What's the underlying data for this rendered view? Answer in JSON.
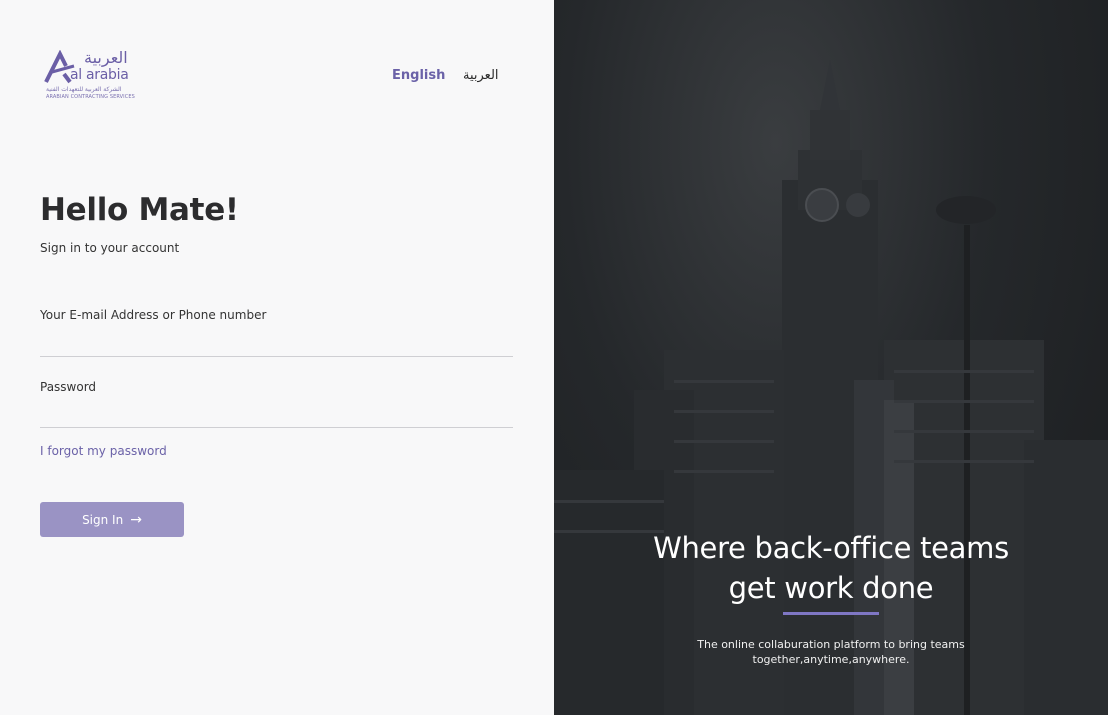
{
  "logo": {
    "arabic_name": "العربية",
    "english_name": "al arabia",
    "arabic_subtitle": "الشركة العربية للتعهدات الفنية",
    "english_subtitle": "ARABIAN CONTRACTING SERVICES"
  },
  "language": {
    "english": "English",
    "arabic": "العربية",
    "selected": "English"
  },
  "login": {
    "title": "Hello Mate!",
    "subtitle": "Sign in to your account",
    "email_label": "Your E-mail Address or Phone number",
    "password_label": "Password",
    "forgot_password": "I forgot my password",
    "sign_in_button": "Sign In",
    "sign_in_icon": "arrow-right-icon"
  },
  "hero": {
    "tagline_line1": "Where back-office teams",
    "tagline_line2": "get work done",
    "description_line1": "The online collaburation platform to bring teams",
    "description_line2": "together,anytime,anywhere."
  },
  "colors": {
    "brand": "#6b62a8",
    "button": "#9a93c4",
    "accent_underline": "#7f77c4",
    "left_bg": "#f8f8f9",
    "right_overlay": "#25282b"
  }
}
